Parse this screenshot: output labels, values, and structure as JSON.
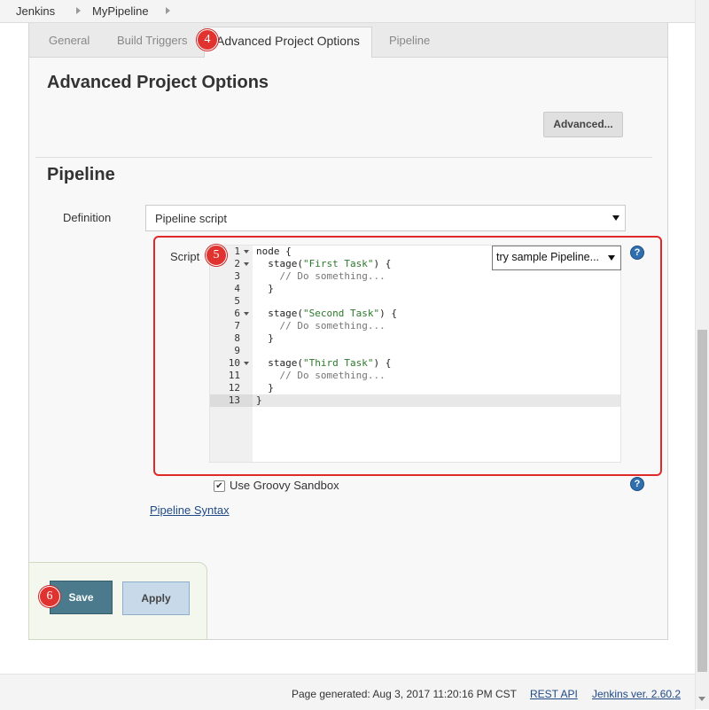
{
  "breadcrumb": {
    "items": [
      "Jenkins",
      "MyPipeline"
    ]
  },
  "tabs": [
    {
      "label": "General"
    },
    {
      "label": "Build Triggers"
    },
    {
      "label": "Advanced Project Options"
    },
    {
      "label": "Pipeline"
    }
  ],
  "annotations": {
    "step4": "4",
    "step5": "5",
    "step6": "6"
  },
  "advanced_section": {
    "title": "Advanced Project Options",
    "button": "Advanced..."
  },
  "pipeline_section": {
    "title": "Pipeline",
    "definition_label": "Definition",
    "definition_value": "Pipeline script",
    "script_label": "Script",
    "sample_select": "try sample Pipeline...",
    "code_lines": [
      "node {",
      "  stage(\"First Task\") {",
      "    // Do something...",
      "  }",
      "",
      "  stage(\"Second Task\") {",
      "    // Do something...",
      "  }",
      "",
      "  stage(\"Third Task\") {",
      "    // Do something...",
      "  }",
      "}"
    ],
    "line_numbers": [
      "1",
      "2",
      "3",
      "4",
      "5",
      "6",
      "7",
      "8",
      "9",
      "10",
      "11",
      "12",
      "13"
    ],
    "sandbox_label": "Use Groovy Sandbox",
    "sandbox_checked": true,
    "syntax_link": "Pipeline Syntax"
  },
  "buttons": {
    "save": "Save",
    "apply": "Apply"
  },
  "footer": {
    "generated": "Page generated: Aug 3, 2017 11:20:16 PM CST",
    "rest_api": "REST API",
    "version": "Jenkins ver. 2.60.2"
  },
  "colors": {
    "annotation_red": "#e0332f",
    "save_button": "#4a7a8c",
    "apply_button": "#c8daea"
  }
}
